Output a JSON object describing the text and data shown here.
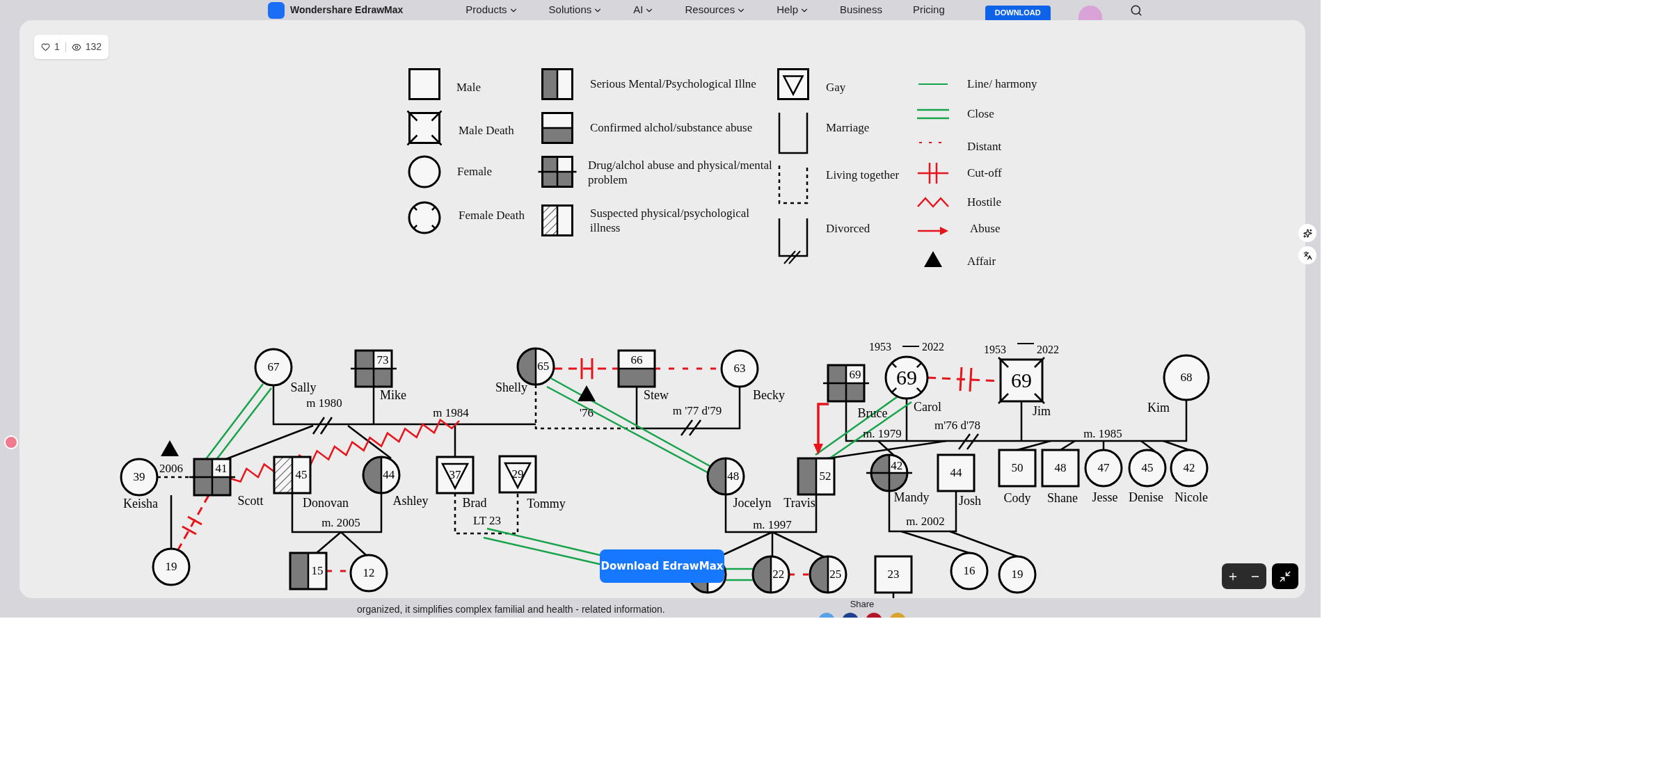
{
  "header": {
    "brand": "Wondershare EdrawMax",
    "nav": [
      {
        "label": "Products",
        "has_menu": true
      },
      {
        "label": "Solutions",
        "has_menu": true
      },
      {
        "label": "AI",
        "has_menu": true
      },
      {
        "label": "Resources",
        "has_menu": true
      },
      {
        "label": "Help",
        "has_menu": true
      },
      {
        "label": "Business",
        "has_menu": false
      },
      {
        "label": "Pricing",
        "has_menu": false
      }
    ],
    "download": "DOWNLOAD"
  },
  "stats": {
    "likes": "1",
    "views": "132"
  },
  "legend": [
    {
      "kind": "male",
      "label": "Male"
    },
    {
      "kind": "male_death",
      "label": "Male Death"
    },
    {
      "kind": "female",
      "label": "Female"
    },
    {
      "kind": "female_death",
      "label": "Female Death"
    },
    {
      "kind": "serious_illness",
      "label": "Serious Mental/Psychological Illne"
    },
    {
      "kind": "substance_abuse",
      "label": "Confirmed alchol/substance abuse"
    },
    {
      "kind": "drug_and_illness",
      "label": "Drug/alchol abuse and physical/mental problem"
    },
    {
      "kind": "suspected_illness",
      "label": "Suspected physical/psychological illness"
    },
    {
      "kind": "gay",
      "label": "Gay"
    },
    {
      "kind": "marriage",
      "label": "Marriage"
    },
    {
      "kind": "living_together",
      "label": "Living together"
    },
    {
      "kind": "divorced",
      "label": "Divorced"
    },
    {
      "kind": "harmony",
      "label": "Line/ harmony"
    },
    {
      "kind": "close",
      "label": "Close"
    },
    {
      "kind": "distant",
      "label": "Distant"
    },
    {
      "kind": "cutoff",
      "label": "Cut-off"
    },
    {
      "kind": "hostile",
      "label": "Hostile"
    },
    {
      "kind": "abuse",
      "label": "Abuse"
    },
    {
      "kind": "affair",
      "label": "Affair"
    }
  ],
  "genogram": {
    "people": [
      {
        "kind": "female",
        "age": "67",
        "name": "Sally",
        "mental_illness": false,
        "substance_abuse": false,
        "suspected_illness": false,
        "gay": false,
        "deceased": false
      },
      {
        "kind": "male",
        "age": "73",
        "name": "Mike",
        "mental_illness": true,
        "substance_abuse": true,
        "suspected_illness": false,
        "gay": false,
        "deceased": false
      },
      {
        "kind": "female",
        "age": "65",
        "name": "Shelly",
        "mental_illness": true,
        "substance_abuse": false,
        "suspected_illness": false,
        "gay": false,
        "deceased": false
      },
      {
        "kind": "male",
        "age": "66",
        "name": "Stew",
        "mental_illness": false,
        "substance_abuse": true,
        "suspected_illness": false,
        "gay": false,
        "deceased": false
      },
      {
        "kind": "female",
        "age": "63",
        "name": "Becky",
        "mental_illness": false,
        "substance_abuse": false,
        "suspected_illness": false,
        "gay": false,
        "deceased": false
      },
      {
        "kind": "male",
        "age": "69",
        "name": "Bruce",
        "mental_illness": true,
        "substance_abuse": true,
        "suspected_illness": false,
        "gay": false,
        "deceased": false
      },
      {
        "kind": "female",
        "age": "69",
        "name": "Carol",
        "mental_illness": false,
        "substance_abuse": false,
        "suspected_illness": false,
        "gay": false,
        "deceased": true,
        "born": "1953",
        "died": "2022"
      },
      {
        "kind": "male",
        "age": "69",
        "name": "Jim",
        "mental_illness": false,
        "substance_abuse": false,
        "suspected_illness": false,
        "gay": false,
        "deceased": true,
        "born": "1953",
        "died": "2022"
      },
      {
        "kind": "female",
        "age": "68",
        "name": "Kim",
        "mental_illness": false,
        "substance_abuse": false,
        "suspected_illness": false,
        "gay": false,
        "deceased": false
      },
      {
        "kind": "female",
        "age": "39",
        "name": "Keisha",
        "mental_illness": false,
        "substance_abuse": false,
        "suspected_illness": false,
        "gay": false,
        "deceased": false
      },
      {
        "kind": "male",
        "age": "41",
        "name": "Scott",
        "mental_illness": true,
        "substance_abuse": true,
        "suspected_illness": false,
        "gay": false,
        "deceased": false
      },
      {
        "kind": "male",
        "age": "45",
        "name": "Donovan",
        "mental_illness": false,
        "substance_abuse": false,
        "suspected_illness": true,
        "gay": false,
        "deceased": false
      },
      {
        "kind": "female",
        "age": "44",
        "name": "Ashley",
        "mental_illness": true,
        "substance_abuse": false,
        "suspected_illness": false,
        "gay": false,
        "deceased": false
      },
      {
        "kind": "male",
        "age": "37",
        "name": "Brad",
        "mental_illness": false,
        "substance_abuse": false,
        "suspected_illness": false,
        "gay": true,
        "deceased": false
      },
      {
        "kind": "male",
        "age": "29",
        "name": "Tommy",
        "mental_illness": false,
        "substance_abuse": false,
        "suspected_illness": false,
        "gay": true,
        "deceased": false
      },
      {
        "kind": "female",
        "age": "48",
        "name": "Jocelyn",
        "mental_illness": true,
        "substance_abuse": false,
        "suspected_illness": false,
        "gay": false,
        "deceased": false
      },
      {
        "kind": "male",
        "age": "52",
        "name": "Travis",
        "mental_illness": true,
        "substance_abuse": false,
        "suspected_illness": false,
        "gay": false,
        "deceased": false
      },
      {
        "kind": "female",
        "age": "42",
        "name": "Mandy",
        "mental_illness": true,
        "substance_abuse": true,
        "suspected_illness": false,
        "gay": false,
        "deceased": false
      },
      {
        "kind": "male",
        "age": "44",
        "name": "Josh",
        "mental_illness": false,
        "substance_abuse": false,
        "suspected_illness": false,
        "gay": false,
        "deceased": false
      },
      {
        "kind": "male",
        "age": "50",
        "name": "Cody",
        "mental_illness": false,
        "substance_abuse": false,
        "suspected_illness": false,
        "gay": false,
        "deceased": false
      },
      {
        "kind": "male",
        "age": "48",
        "name": "Shane",
        "mental_illness": false,
        "substance_abuse": false,
        "suspected_illness": false,
        "gay": false,
        "deceased": false
      },
      {
        "kind": "female",
        "age": "47",
        "name": "Jesse",
        "mental_illness": false,
        "substance_abuse": false,
        "suspected_illness": false,
        "gay": false,
        "deceased": false
      },
      {
        "kind": "female",
        "age": "45",
        "name": "Denise",
        "mental_illness": false,
        "substance_abuse": false,
        "suspected_illness": false,
        "gay": false,
        "deceased": false
      },
      {
        "kind": "female",
        "age": "42",
        "name": "Nicole",
        "mental_illness": false,
        "substance_abuse": false,
        "suspected_illness": false,
        "gay": false,
        "deceased": false
      },
      {
        "kind": "female",
        "age": "19",
        "mental_illness": false,
        "substance_abuse": false,
        "suspected_illness": false,
        "gay": false,
        "deceased": false
      },
      {
        "kind": "male",
        "age": "15",
        "mental_illness": true,
        "substance_abuse": false,
        "suspected_illness": false,
        "gay": false,
        "deceased": false
      },
      {
        "kind": "female",
        "age": "12",
        "mental_illness": false,
        "substance_abuse": false,
        "suspected_illness": false,
        "gay": false,
        "deceased": false
      },
      {
        "kind": "female",
        "mental_illness": true,
        "substance_abuse": false,
        "suspected_illness": false,
        "gay": false,
        "deceased": false
      },
      {
        "kind": "female",
        "age": "22",
        "mental_illness": true,
        "substance_abuse": false,
        "suspected_illness": false,
        "gay": false,
        "deceased": false
      },
      {
        "kind": "female",
        "age": "25",
        "mental_illness": true,
        "substance_abuse": false,
        "suspected_illness": false,
        "gay": false,
        "deceased": false
      },
      {
        "kind": "male",
        "age": "23",
        "mental_illness": false,
        "substance_abuse": false,
        "suspected_illness": false,
        "gay": false,
        "deceased": false
      },
      {
        "kind": "female",
        "age": "16",
        "mental_illness": false,
        "substance_abuse": false,
        "suspected_illness": false,
        "gay": false,
        "deceased": false
      },
      {
        "kind": "female",
        "age": "19",
        "mental_illness": false,
        "substance_abuse": false,
        "suspected_illness": false,
        "gay": false,
        "deceased": false
      }
    ],
    "relation_labels": [
      "m 1980",
      "m 1984",
      "'76",
      "m '77 d'79",
      "2006",
      "m. 2005",
      "LT 23",
      "m. 1997",
      "m. 1979",
      "m'76 d'78",
      "m. 1985",
      "m. 2002"
    ],
    "download_button": "Download EdrawMax"
  },
  "footer": {
    "text": "organized, it simplifies complex familial and health - related information.",
    "share": "Share"
  }
}
